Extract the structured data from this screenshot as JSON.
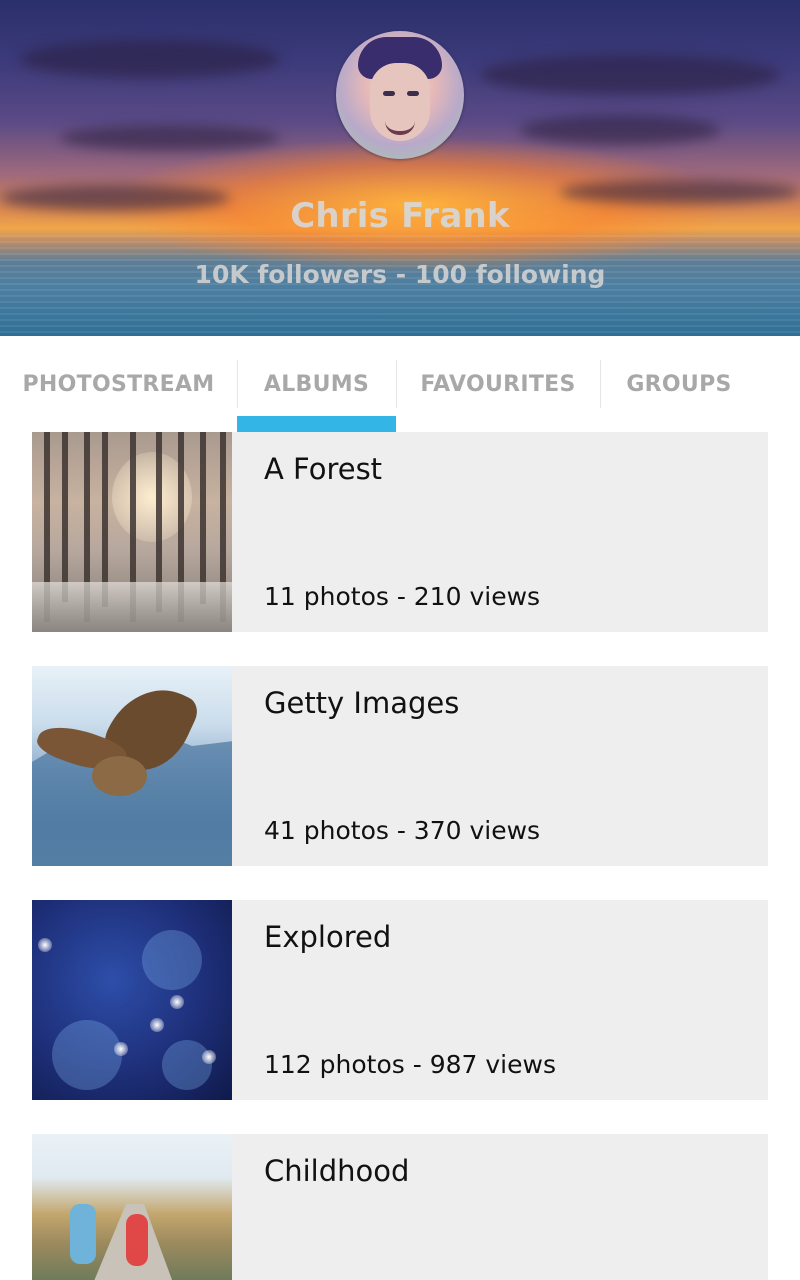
{
  "profile": {
    "name": "Chris Frank",
    "stats": "10K followers - 100 following"
  },
  "tabs": [
    {
      "label": "PHOTOSTREAM",
      "selected": false
    },
    {
      "label": "ALBUMS",
      "selected": true
    },
    {
      "label": "FAVOURITES",
      "selected": false
    },
    {
      "label": "GROUPS",
      "selected": false
    }
  ],
  "colors": {
    "accent": "#33b5e5",
    "card_background": "#eeeeee",
    "tab_text": "#a8a8a8"
  },
  "albums": [
    {
      "title": "A Forest",
      "meta": "11 photos - 210 views",
      "thumbnail": "forest-photo"
    },
    {
      "title": "Getty Images",
      "meta": "41 photos - 370 views",
      "thumbnail": "owl-photo"
    },
    {
      "title": "Explored",
      "meta": "112 photos - 987 views",
      "thumbnail": "dandelion-photo"
    },
    {
      "title": "Childhood",
      "meta": "",
      "thumbnail": "children-road-photo"
    }
  ]
}
